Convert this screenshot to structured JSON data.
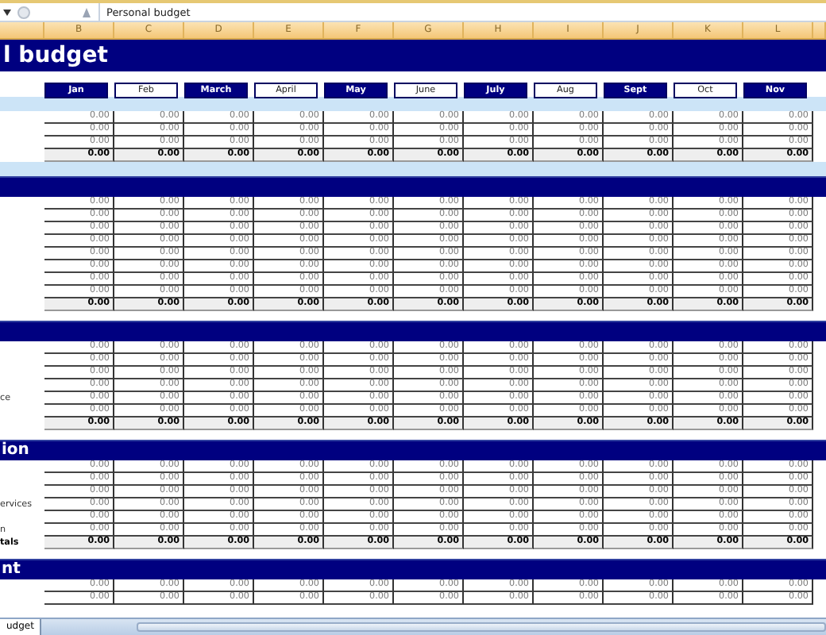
{
  "formula_bar": {
    "formula": "Personal budget"
  },
  "column_headers": [
    "B",
    "C",
    "D",
    "E",
    "F",
    "G",
    "H",
    "I",
    "J",
    "K",
    "L"
  ],
  "title": "l budget",
  "months": [
    {
      "label": "Jan",
      "shaded": true
    },
    {
      "label": "Feb",
      "shaded": false
    },
    {
      "label": "March",
      "shaded": true
    },
    {
      "label": "April",
      "shaded": false
    },
    {
      "label": "May",
      "shaded": true
    },
    {
      "label": "June",
      "shaded": false
    },
    {
      "label": "July",
      "shaded": true
    },
    {
      "label": "Aug",
      "shaded": false
    },
    {
      "label": "Sept",
      "shaded": true
    },
    {
      "label": "Oct",
      "shaded": false
    },
    {
      "label": "Nov",
      "shaded": true
    }
  ],
  "sections": [
    {
      "kind": "band",
      "rows": [
        {
          "values": [
            "0.00",
            "0.00",
            "0.00",
            "0.00",
            "0.00",
            "0.00",
            "0.00",
            "0.00",
            "0.00",
            "0.00",
            "0.00"
          ]
        },
        {
          "values": [
            "0.00",
            "0.00",
            "0.00",
            "0.00",
            "0.00",
            "0.00",
            "0.00",
            "0.00",
            "0.00",
            "0.00",
            "0.00"
          ]
        },
        {
          "values": [
            "0.00",
            "0.00",
            "0.00",
            "0.00",
            "0.00",
            "0.00",
            "0.00",
            "0.00",
            "0.00",
            "0.00",
            "0.00"
          ]
        }
      ],
      "total": {
        "values": [
          "0.00",
          "0.00",
          "0.00",
          "0.00",
          "0.00",
          "0.00",
          "0.00",
          "0.00",
          "0.00",
          "0.00",
          "0.00"
        ]
      }
    },
    {
      "kind": "header",
      "rows": [
        {
          "values": [
            "0.00",
            "0.00",
            "0.00",
            "0.00",
            "0.00",
            "0.00",
            "0.00",
            "0.00",
            "0.00",
            "0.00",
            "0.00"
          ]
        },
        {
          "values": [
            "0.00",
            "0.00",
            "0.00",
            "0.00",
            "0.00",
            "0.00",
            "0.00",
            "0.00",
            "0.00",
            "0.00",
            "0.00"
          ]
        },
        {
          "values": [
            "0.00",
            "0.00",
            "0.00",
            "0.00",
            "0.00",
            "0.00",
            "0.00",
            "0.00",
            "0.00",
            "0.00",
            "0.00"
          ]
        },
        {
          "values": [
            "0.00",
            "0.00",
            "0.00",
            "0.00",
            "0.00",
            "0.00",
            "0.00",
            "0.00",
            "0.00",
            "0.00",
            "0.00"
          ]
        },
        {
          "values": [
            "0.00",
            "0.00",
            "0.00",
            "0.00",
            "0.00",
            "0.00",
            "0.00",
            "0.00",
            "0.00",
            "0.00",
            "0.00"
          ]
        },
        {
          "values": [
            "0.00",
            "0.00",
            "0.00",
            "0.00",
            "0.00",
            "0.00",
            "0.00",
            "0.00",
            "0.00",
            "0.00",
            "0.00"
          ]
        },
        {
          "values": [
            "0.00",
            "0.00",
            "0.00",
            "0.00",
            "0.00",
            "0.00",
            "0.00",
            "0.00",
            "0.00",
            "0.00",
            "0.00"
          ]
        },
        {
          "values": [
            "0.00",
            "0.00",
            "0.00",
            "0.00",
            "0.00",
            "0.00",
            "0.00",
            "0.00",
            "0.00",
            "0.00",
            "0.00"
          ]
        }
      ],
      "total": {
        "values": [
          "0.00",
          "0.00",
          "0.00",
          "0.00",
          "0.00",
          "0.00",
          "0.00",
          "0.00",
          "0.00",
          "0.00",
          "0.00"
        ]
      }
    },
    {
      "kind": "header",
      "rows": [
        {
          "values": [
            "0.00",
            "0.00",
            "0.00",
            "0.00",
            "0.00",
            "0.00",
            "0.00",
            "0.00",
            "0.00",
            "0.00",
            "0.00"
          ]
        },
        {
          "values": [
            "0.00",
            "0.00",
            "0.00",
            "0.00",
            "0.00",
            "0.00",
            "0.00",
            "0.00",
            "0.00",
            "0.00",
            "0.00"
          ]
        },
        {
          "values": [
            "0.00",
            "0.00",
            "0.00",
            "0.00",
            "0.00",
            "0.00",
            "0.00",
            "0.00",
            "0.00",
            "0.00",
            "0.00"
          ]
        },
        {
          "values": [
            "0.00",
            "0.00",
            "0.00",
            "0.00",
            "0.00",
            "0.00",
            "0.00",
            "0.00",
            "0.00",
            "0.00",
            "0.00"
          ]
        },
        {
          "label": "ce",
          "values": [
            "0.00",
            "0.00",
            "0.00",
            "0.00",
            "0.00",
            "0.00",
            "0.00",
            "0.00",
            "0.00",
            "0.00",
            "0.00"
          ]
        },
        {
          "values": [
            "0.00",
            "0.00",
            "0.00",
            "0.00",
            "0.00",
            "0.00",
            "0.00",
            "0.00",
            "0.00",
            "0.00",
            "0.00"
          ]
        }
      ],
      "total": {
        "values": [
          "0.00",
          "0.00",
          "0.00",
          "0.00",
          "0.00",
          "0.00",
          "0.00",
          "0.00",
          "0.00",
          "0.00",
          "0.00"
        ]
      }
    },
    {
      "kind": "header",
      "title": "ion",
      "rows": [
        {
          "values": [
            "0.00",
            "0.00",
            "0.00",
            "0.00",
            "0.00",
            "0.00",
            "0.00",
            "0.00",
            "0.00",
            "0.00",
            "0.00"
          ]
        },
        {
          "values": [
            "0.00",
            "0.00",
            "0.00",
            "0.00",
            "0.00",
            "0.00",
            "0.00",
            "0.00",
            "0.00",
            "0.00",
            "0.00"
          ]
        },
        {
          "values": [
            "0.00",
            "0.00",
            "0.00",
            "0.00",
            "0.00",
            "0.00",
            "0.00",
            "0.00",
            "0.00",
            "0.00",
            "0.00"
          ]
        },
        {
          "label": "ervices",
          "values": [
            "0.00",
            "0.00",
            "0.00",
            "0.00",
            "0.00",
            "0.00",
            "0.00",
            "0.00",
            "0.00",
            "0.00",
            "0.00"
          ]
        },
        {
          "values": [
            "0.00",
            "0.00",
            "0.00",
            "0.00",
            "0.00",
            "0.00",
            "0.00",
            "0.00",
            "0.00",
            "0.00",
            "0.00"
          ]
        },
        {
          "label": "n",
          "values": [
            "0.00",
            "0.00",
            "0.00",
            "0.00",
            "0.00",
            "0.00",
            "0.00",
            "0.00",
            "0.00",
            "0.00",
            "0.00"
          ]
        }
      ],
      "total": {
        "label": "tals",
        "values": [
          "0.00",
          "0.00",
          "0.00",
          "0.00",
          "0.00",
          "0.00",
          "0.00",
          "0.00",
          "0.00",
          "0.00",
          "0.00"
        ]
      }
    },
    {
      "kind": "header",
      "title": "nt",
      "rows": [
        {
          "values": [
            "0.00",
            "0.00",
            "0.00",
            "0.00",
            "0.00",
            "0.00",
            "0.00",
            "0.00",
            "0.00",
            "0.00",
            "0.00"
          ]
        },
        {
          "values": [
            "0.00",
            "0.00",
            "0.00",
            "0.00",
            "0.00",
            "0.00",
            "0.00",
            "0.00",
            "0.00",
            "0.00",
            "0.00"
          ]
        }
      ]
    }
  ],
  "sheet_tabs": [
    {
      "label": "udget",
      "selected": true
    }
  ]
}
